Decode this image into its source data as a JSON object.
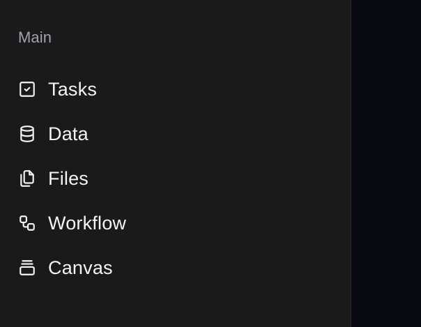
{
  "sidebar": {
    "section_label": "Main",
    "items": [
      {
        "label": "Tasks",
        "icon": "square-check-icon"
      },
      {
        "label": "Data",
        "icon": "database-icon"
      },
      {
        "label": "Files",
        "icon": "files-icon"
      },
      {
        "label": "Workflow",
        "icon": "workflow-icon"
      },
      {
        "label": "Canvas",
        "icon": "layers-icon"
      }
    ]
  },
  "colors": {
    "sidebar_bg": "#1a1a1c",
    "main_bg": "#090b12",
    "text_primary": "#f4f4f5",
    "text_muted": "#a1a1aa"
  }
}
